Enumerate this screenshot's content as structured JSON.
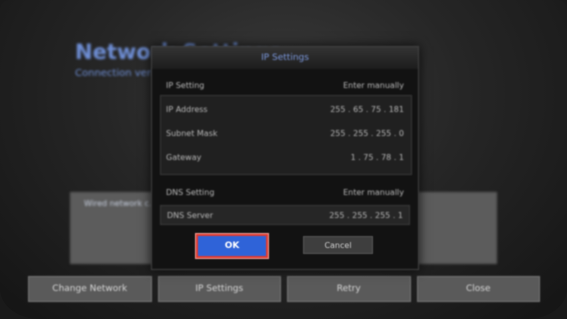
{
  "background": {
    "title": "Network Settings",
    "subtitle": "Connection verification",
    "panel_text": "Wired network c...",
    "bottom_buttons": [
      "Change Network",
      "IP Settings",
      "Retry",
      "Close"
    ]
  },
  "dialog": {
    "title": "IP Settings",
    "ip_setting": {
      "label": "IP Setting",
      "value": "Enter manually"
    },
    "ip_address": {
      "label": "IP Address",
      "value": "255 . 65 . 75 . 181"
    },
    "subnet_mask": {
      "label": "Subnet Mask",
      "value": "255 . 255 . 255 . 0"
    },
    "gateway": {
      "label": "Gateway",
      "value": "1 . 75 . 78 . 1"
    },
    "dns_setting": {
      "label": "DNS Setting",
      "value": "Enter manually"
    },
    "dns_server": {
      "label": "DNS Server",
      "value": "255 . 255 . 255 . 1"
    },
    "ok_label": "OK",
    "cancel_label": "Cancel"
  },
  "colors": {
    "accent": "#2f63d8",
    "highlight": "#e23b2f",
    "title_text": "#7d9adf"
  }
}
